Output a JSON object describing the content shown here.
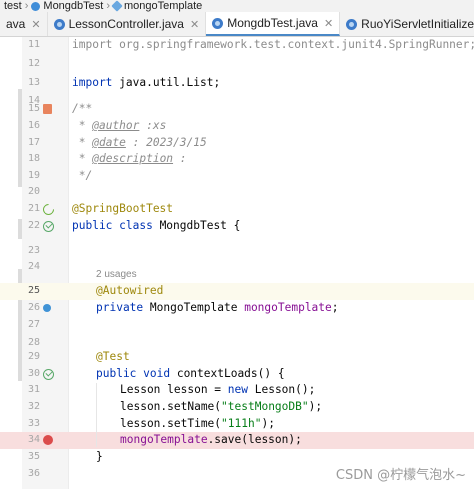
{
  "breadcrumb": {
    "items": [
      "test",
      "MongdbTest",
      "mongoTemplate"
    ]
  },
  "tabs": [
    {
      "label": "ava",
      "active": false,
      "overflow": true
    },
    {
      "label": "LessonController.java",
      "active": false
    },
    {
      "label": "MongdbTest.java",
      "active": true
    },
    {
      "label": "RuoYiServletInitializer.java",
      "active": false
    }
  ],
  "code_lines": [
    {
      "n": "11",
      "text": "import org.springframework.test.context.junit4.SpringRunner;"
    },
    {
      "n": "12",
      "text": ""
    },
    {
      "n": "13",
      "text": "import java.util.List;"
    },
    {
      "n": "14",
      "text": ""
    },
    {
      "n": "15",
      "text": "/**"
    },
    {
      "n": "16",
      "text": " * @author :xs"
    },
    {
      "n": "17",
      "text": " * @date : 2023/3/15"
    },
    {
      "n": "18",
      "text": " * @description :"
    },
    {
      "n": "19",
      "text": " */"
    },
    {
      "n": "20",
      "text": ""
    },
    {
      "n": "21",
      "text": "@SpringBootTest"
    },
    {
      "n": "22",
      "text": "public class MongdbTest {"
    },
    {
      "n": "23",
      "text": ""
    },
    {
      "n": "24",
      "text": ""
    },
    {
      "n": "",
      "text": "2 usages"
    },
    {
      "n": "25",
      "text": "    @Autowired"
    },
    {
      "n": "26",
      "text": "    private MongoTemplate mongoTemplate;"
    },
    {
      "n": "27",
      "text": ""
    },
    {
      "n": "28",
      "text": ""
    },
    {
      "n": "29",
      "text": "    @Test"
    },
    {
      "n": "30",
      "text": "    public void contextLoads() {"
    },
    {
      "n": "31",
      "text": "        Lesson lesson = new Lesson();"
    },
    {
      "n": "32",
      "text": "        lesson.setName(\"testMongoDB\");"
    },
    {
      "n": "33",
      "text": "        lesson.setTime(\"111h\");"
    },
    {
      "n": "34",
      "text": "        mongoTemplate.save(lesson);"
    },
    {
      "n": "35",
      "text": "    }"
    },
    {
      "n": "36",
      "text": ""
    }
  ],
  "code_parts": {
    "l11": "import org.springframework.test.context.junit4.SpringRunner;",
    "l13_kw": "import",
    "l13_rest": " java.util.List;",
    "l15": "/**",
    "l16_a": " * ",
    "l16_tag": "@author",
    "l16_b": " :xs",
    "l17_a": " * ",
    "l17_tag": "@date",
    "l17_b": " : 2023/3/15",
    "l18_a": " * ",
    "l18_tag": "@description",
    "l18_b": " :",
    "l19": " */",
    "l21": "@SpringBootTest",
    "l22_kw": "public class",
    "l22_rest": " MongdbTest {",
    "usages": "2 usages",
    "l25": "@Autowired",
    "l26_kw": "private",
    "l26_type": " MongoTemplate ",
    "l26_field": "mongoTemplate",
    "l26_end": ";",
    "l29": "@Test",
    "l30_kw": "public void",
    "l30_rest": " contextLoads() {",
    "l31_a": "Lesson lesson = ",
    "l31_kw": "new",
    "l31_b": " Lesson();",
    "l32_a": "lesson.setName(",
    "l32_str": "\"testMongoDB\"",
    "l32_b": ");",
    "l33_a": "lesson.setTime(",
    "l33_str": "\"111h\"",
    "l33_b": ");",
    "l34_field": "mongoTemplate",
    "l34_b": ".save(lesson);",
    "l35": "}"
  },
  "watermark": "CSDN @柠檬气泡水~",
  "colors": {
    "keyword": "#0033b3",
    "string": "#067d17",
    "annotation": "#9e880d",
    "comment": "#8c8c8c",
    "field": "#871094",
    "breakpoint_line": "#f8dede"
  }
}
